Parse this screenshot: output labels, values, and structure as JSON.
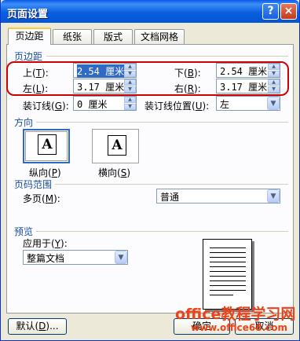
{
  "window": {
    "title": "页面设置",
    "help_glyph": "?",
    "close_glyph": "×"
  },
  "tabs": [
    {
      "label": "页边距",
      "active": true
    },
    {
      "label": "纸张",
      "active": false
    },
    {
      "label": "版式",
      "active": false
    },
    {
      "label": "文档网格",
      "active": false
    }
  ],
  "margins": {
    "section_title": "页边距",
    "top": {
      "label": "上",
      "key": "T",
      "value": "2.54 厘米"
    },
    "bottom": {
      "label": "下",
      "key": "B",
      "value": "2.54 厘米"
    },
    "left": {
      "label": "左",
      "key": "L",
      "value": "3.17 厘米"
    },
    "right": {
      "label": "右",
      "key": "R",
      "value": "3.17 厘米"
    },
    "gutter": {
      "label": "装订线",
      "key": "G",
      "value": "0 厘米"
    },
    "gutter_position": {
      "label": "装订线位置",
      "key": "U",
      "value": "左"
    }
  },
  "orientation": {
    "section_title": "方向",
    "portrait": {
      "label": "纵向",
      "key": "P",
      "glyph": "A",
      "selected": true
    },
    "landscape": {
      "label": "横向",
      "key": "S",
      "glyph": "A",
      "selected": false
    }
  },
  "pages": {
    "section_title": "页码范围",
    "multiple_label": "多页",
    "multiple_key": "M",
    "multiple_value": "普通"
  },
  "preview": {
    "section_title": "预览",
    "apply_to_label": "应用于",
    "apply_to_key": "Y",
    "apply_to_value": "整篇文档"
  },
  "buttons": {
    "default": {
      "label": "默认",
      "key": "D",
      "suffix": "..."
    },
    "ok": {
      "label": "确定"
    },
    "cancel": {
      "label": "取消"
    }
  },
  "watermark": {
    "line1": "office教程学习网",
    "line2": "www.office68.com"
  },
  "colors": {
    "title_bar": "#0a5ae8",
    "highlight": "#d10000",
    "watermark": "#e8451e",
    "group_title": "#1a4fa0"
  }
}
